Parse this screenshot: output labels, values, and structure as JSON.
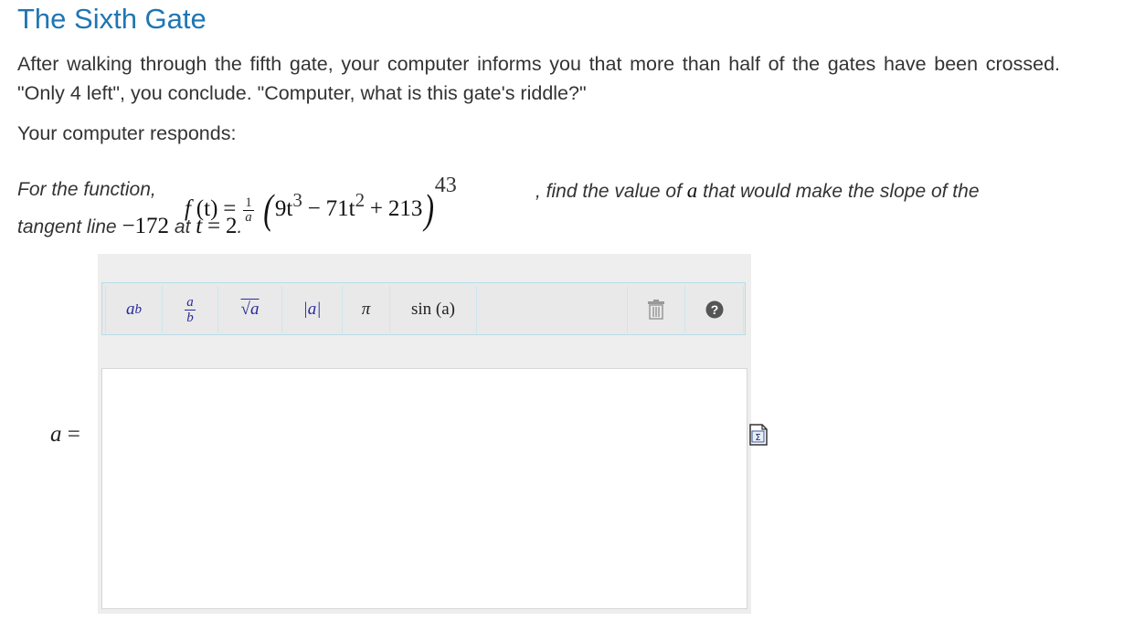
{
  "title": "The Sixth Gate",
  "intro": "After walking through the fifth gate, your computer informs you that more than half of the gates have been crossed. \"Only 4 left\", you conclude. \"Computer, what is this gate's riddle?\"",
  "responds": "Your computer responds:",
  "question": {
    "prefix": "For the function,",
    "func_f": "f",
    "func_t": "(t)",
    "equals": "=",
    "frac_num": "1",
    "frac_den": "a",
    "term1": "9t",
    "exp1": "3",
    "minus": "−",
    "term2": "71t",
    "exp2": "2",
    "plus": "+",
    "term3": "213",
    "outer_exp": "43",
    "middle": ", find the value of",
    "var_a": "a",
    "suffix": "that would make the slope of the",
    "line2_start": "tangent line",
    "slope_value": "−172",
    "at": "at",
    "t_var": "t",
    "eq2": "=",
    "t_value": "2",
    "period": "."
  },
  "toolbar": {
    "power_label": "a",
    "power_sup": "b",
    "frac_num": "a",
    "frac_den": "b",
    "sqrt_label": "√a",
    "abs_label": "|a|",
    "pi_label": "π",
    "sin_label": "sin (a)"
  },
  "answer": {
    "label_var": "a",
    "label_eq": "=",
    "value": ""
  },
  "icons": [
    "trash-icon",
    "help-icon",
    "sigma-icon"
  ],
  "colors": {
    "title": "#1f76b3",
    "toolbar_text": "#2a2a9a",
    "toolbar_border": "#b8dde8"
  }
}
